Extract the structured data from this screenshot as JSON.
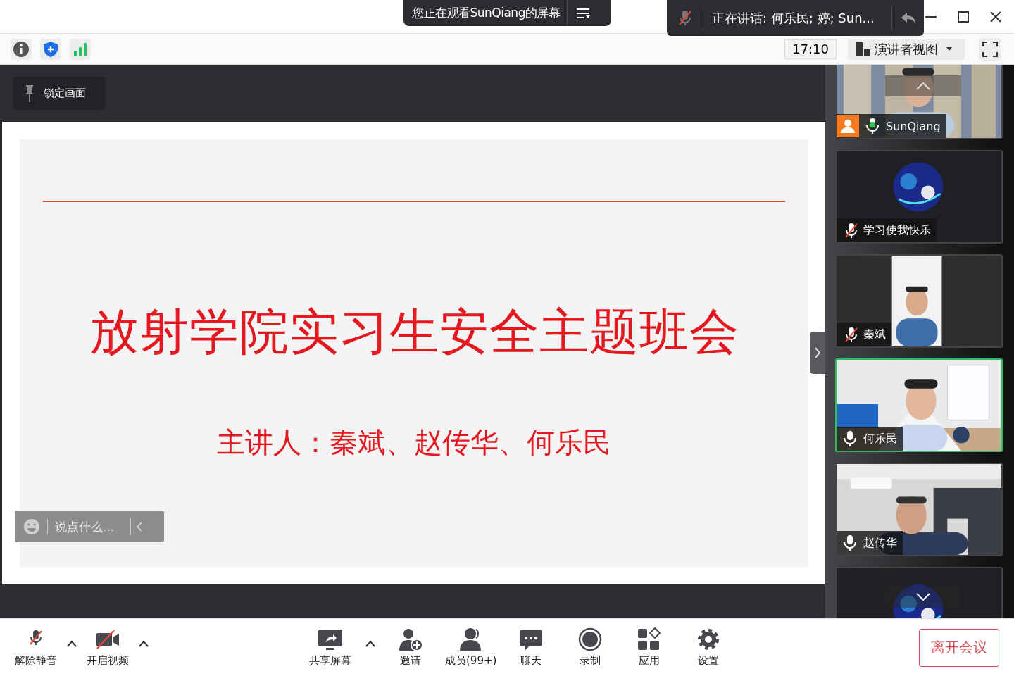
{
  "viewing_banner": {
    "text": "您正在观看SunQiang的屏幕"
  },
  "speaking_popup": {
    "muted": true,
    "text": "正在讲话: 何乐民; 婷; Sun..."
  },
  "toolbar": {
    "time": "17:10",
    "view_button": "演讲者视图"
  },
  "share": {
    "pin_tooltip": "锁定画面",
    "slide": {
      "title": "放射学院实习生安全主题班会",
      "subtitle": "主讲人：秦斌、赵传华、何乐民"
    },
    "chat_input": {
      "placeholder": "说点什么..."
    }
  },
  "gallery": {
    "tiles": [
      {
        "kind": "video",
        "name": "SunQiang",
        "muted": false,
        "voice_active": true,
        "host": true,
        "speaking": false
      },
      {
        "kind": "avatar",
        "name": "学习使我快乐",
        "muted": true,
        "host": false,
        "speaking": false
      },
      {
        "kind": "portrait",
        "name": "秦斌",
        "muted": true,
        "host": false,
        "speaking": false
      },
      {
        "kind": "video",
        "name": "何乐民",
        "muted": false,
        "voice_active": false,
        "host": false,
        "speaking": true
      },
      {
        "kind": "video",
        "name": "赵传华",
        "muted": false,
        "voice_active": false,
        "host": false,
        "speaking": false
      },
      {
        "kind": "avatar",
        "speaking": false
      }
    ]
  },
  "bottom_bar": {
    "left": [
      {
        "kind": "mic_off",
        "label": "解除静音",
        "has_menu": true
      },
      {
        "kind": "video_off",
        "label": "开启视频",
        "has_menu": true
      }
    ],
    "center": [
      {
        "kind": "share",
        "label": "共享屏幕",
        "has_menu": true
      },
      {
        "kind": "invite",
        "label": "邀请",
        "has_menu": false
      },
      {
        "kind": "members",
        "label": "成员(99+)",
        "has_menu": false
      },
      {
        "kind": "chat",
        "label": "聊天",
        "has_menu": false
      },
      {
        "kind": "record",
        "label": "录制",
        "has_menu": false
      },
      {
        "kind": "apps",
        "label": "应用",
        "has_menu": false
      },
      {
        "kind": "settings",
        "label": "设置",
        "has_menu": false
      }
    ],
    "leave_button": "离开会议"
  }
}
